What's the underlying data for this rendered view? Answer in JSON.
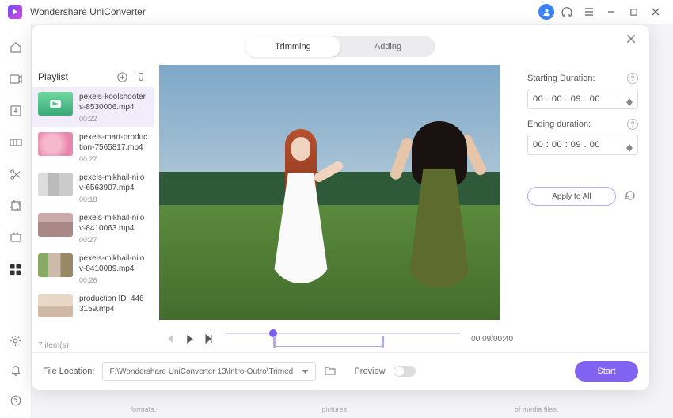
{
  "app": {
    "title": "Wondershare UniConverter"
  },
  "tabs": {
    "trimming": "Trimming",
    "adding": "Adding"
  },
  "playlist": {
    "header": "Playlist",
    "items": [
      {
        "name": "pexels-koolshooters-8530006.mp4",
        "dur": "00:22"
      },
      {
        "name": "pexels-mart-production-7565817.mp4",
        "dur": "00:27"
      },
      {
        "name": "pexels-mikhail-nilov-6563907.mp4",
        "dur": "00:18"
      },
      {
        "name": "pexels-mikhail-nilov-8410063.mp4",
        "dur": "00:27"
      },
      {
        "name": "pexels-mikhail-nilov-8410089.mp4",
        "dur": "00:26"
      },
      {
        "name": "production ID_4463159.mp4",
        "dur": ""
      }
    ],
    "count_label": "7 item(s)"
  },
  "player": {
    "time": "00:09/00:40"
  },
  "right": {
    "start_label": "Starting Duration:",
    "end_label": "Ending duration:",
    "start_val": "00 : 00 : 09 . 00",
    "end_val": "00 : 00 : 09 . 00",
    "apply": "Apply to All"
  },
  "footer": {
    "loc_label": "File Location:",
    "path": "F:\\Wondershare UniConverter 13\\Intro-Outro\\Trimed",
    "preview": "Preview",
    "start": "Start"
  },
  "bg": {
    "a": "formats.",
    "b": "pictures.",
    "c": "of media files."
  }
}
